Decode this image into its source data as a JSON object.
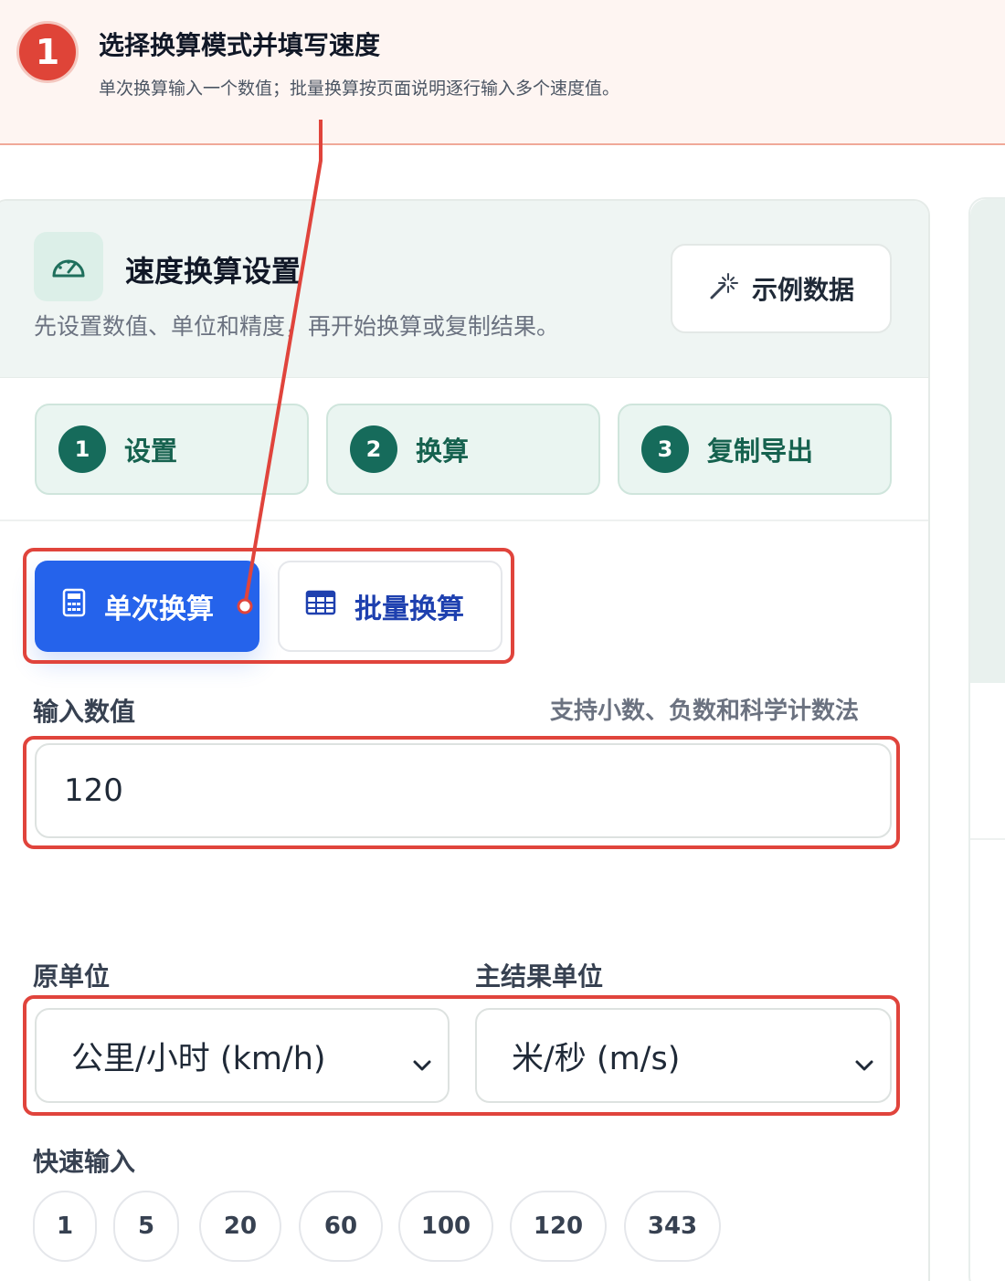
{
  "banner": {
    "step_number": "1",
    "title": "选择换算模式并填写速度",
    "description": "单次换算输入一个数值；批量换算按页面说明逐行输入多个速度值。"
  },
  "card": {
    "header_icon": "speedometer-icon",
    "title": "速度换算设置",
    "subtitle": "先设置数值、单位和精度，再开始换算或复制结果。",
    "sample_button": {
      "icon": "magic-wand-icon",
      "label": "示例数据"
    },
    "steps": [
      {
        "num": "1",
        "label": "设置"
      },
      {
        "num": "2",
        "label": "换算"
      },
      {
        "num": "3",
        "label": "复制导出"
      }
    ],
    "modes": {
      "single": {
        "icon": "calculator-icon",
        "label": "单次换算",
        "active": true
      },
      "batch": {
        "icon": "table-icon",
        "label": "批量换算",
        "active": false
      }
    },
    "input": {
      "label": "输入数值",
      "hint": "支持小数、负数和科学计数法",
      "value": "120"
    },
    "source_unit": {
      "label": "原单位",
      "value": "公里/小时 (km/h)"
    },
    "target_unit": {
      "label": "主结果单位",
      "value": "米/秒 (m/s)"
    },
    "quick_input": {
      "label": "快速输入",
      "values": [
        "1",
        "5",
        "20",
        "60",
        "100",
        "120",
        "343"
      ]
    }
  },
  "colors": {
    "accent_red": "#df4438",
    "primary_blue": "#2563eb",
    "step_green": "#166b5b"
  }
}
